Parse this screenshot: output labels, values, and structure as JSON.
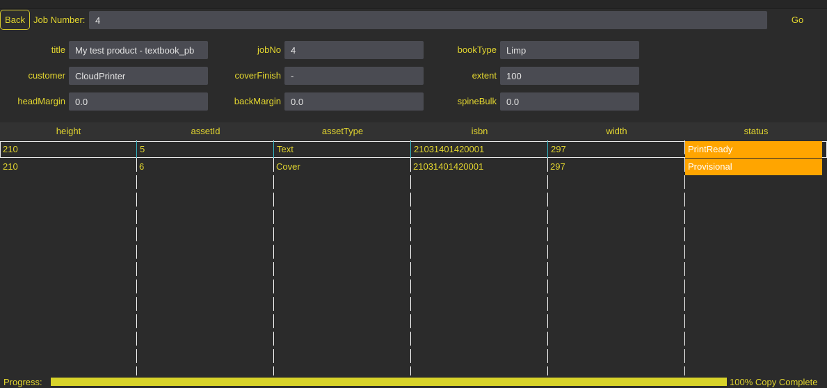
{
  "toolbar": {
    "back_label": "Back",
    "job_number_label": "Job Number:",
    "job_number_value": "4",
    "go_label": "Go"
  },
  "form": {
    "title": {
      "label": "title",
      "value": "My test product - textbook_pb"
    },
    "jobNo": {
      "label": "jobNo",
      "value": "4"
    },
    "bookType": {
      "label": "bookType",
      "value": "Limp"
    },
    "customer": {
      "label": "customer",
      "value": "CloudPrinter"
    },
    "coverFinish": {
      "label": "coverFinish",
      "value": "-"
    },
    "extent": {
      "label": "extent",
      "value": "100"
    },
    "headMargin": {
      "label": "headMargin",
      "value": "0.0"
    },
    "backMargin": {
      "label": "backMargin",
      "value": "0.0"
    },
    "spineBulk": {
      "label": "spineBulk",
      "value": "0.0"
    }
  },
  "table": {
    "columns": [
      "height",
      "assetId",
      "assetType",
      "isbn",
      "width",
      "status"
    ],
    "rows": [
      {
        "height": "210",
        "assetId": "5",
        "assetType": "Text",
        "isbn": "21031401420001",
        "width": "297",
        "status": "PrintReady"
      },
      {
        "height": "210",
        "assetId": "6",
        "assetType": "Cover",
        "isbn": "21031401420001",
        "width": "297",
        "status": "Provisional"
      }
    ],
    "status_color": "#ffa500"
  },
  "progress": {
    "label": "Progress:",
    "percent": 100,
    "percent_text": "100%",
    "status_text": "Copy Complete",
    "color": "#d8d32a"
  }
}
